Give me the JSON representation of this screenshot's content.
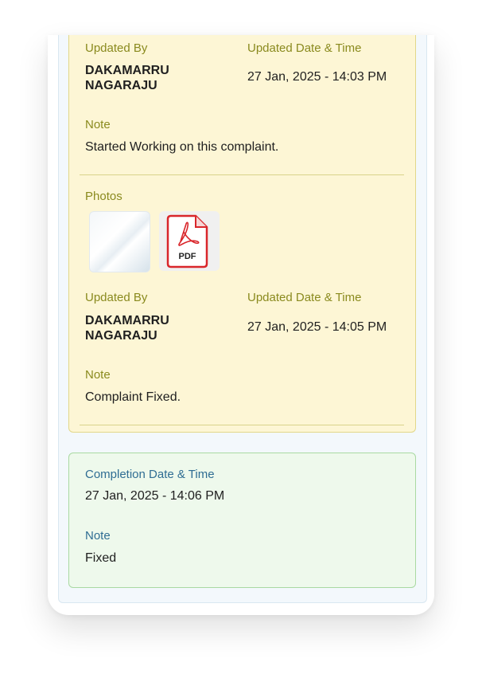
{
  "history": {
    "entries": [
      {
        "updated_by_label": "Updated By",
        "updated_by_line1": "DAKAMARRU",
        "updated_by_line2": "NAGARAJU",
        "datetime_label": "Updated Date & Time",
        "datetime": "27 Jan, 2025 - 14:03 PM",
        "note_label": "Note",
        "note": "Started Working on this complaint."
      },
      {
        "photos_label": "Photos",
        "photos": [
          {
            "kind": "image"
          },
          {
            "kind": "pdf",
            "badge": "PDF"
          }
        ],
        "updated_by_label": "Updated By",
        "updated_by_line1": "DAKAMARRU",
        "updated_by_line2": "NAGARAJU",
        "datetime_label": "Updated Date & Time",
        "datetime": "27 Jan, 2025 - 14:05 PM",
        "note_label": "Note",
        "note": "Complaint Fixed."
      }
    ]
  },
  "completion": {
    "datetime_label": "Completion Date & Time",
    "datetime": "27 Jan, 2025 - 14:06 PM",
    "note_label": "Note",
    "note": "Fixed"
  },
  "colors": {
    "history_bg": "#fdf6d5",
    "history_label": "#8a8a1e",
    "completion_bg": "#eef9ec",
    "completion_label": "#2f6d93",
    "pdf_red": "#d9262b"
  }
}
